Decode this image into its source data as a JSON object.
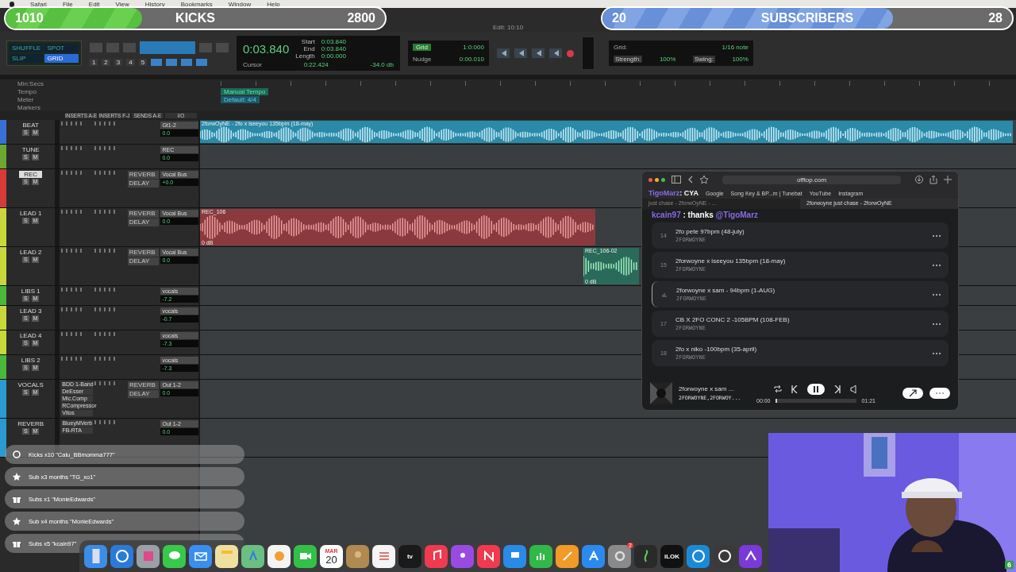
{
  "menu_bar": {
    "items": [
      "Safari",
      "File",
      "Edit",
      "View",
      "History",
      "Bookmarks",
      "Window",
      "Help"
    ]
  },
  "kicks_goal": {
    "current": "1010",
    "label": "KICKS",
    "target": "2800",
    "level": 0.36
  },
  "subs_goal": {
    "current": "20",
    "label": "SUBSCRIBERS",
    "target": "28",
    "level": 0.71
  },
  "edit_window": {
    "title": "Edit: 10:10"
  },
  "toolbar": {
    "edit_modes": [
      {
        "label": "SHUFFLE",
        "selected": false
      },
      {
        "label": "SPOT",
        "selected": false
      },
      {
        "label": "SLIP",
        "selected": false
      },
      {
        "label": "GRID",
        "selected": true
      }
    ],
    "zoom_presets": [
      "1",
      "2",
      "3",
      "4",
      "5"
    ],
    "counter": "0:03.840",
    "start_label": "Start",
    "end_label": "End",
    "length_label": "Length",
    "start": "0:03.840",
    "end": "0:03.840",
    "length": "0:00.000",
    "cursor_label": "Cursor",
    "cursor": "0:22.424",
    "cursor_level": "-34.0 db",
    "grid_mode": "Grid",
    "grid_value": "1:0:000",
    "nudge_label": "Nudge",
    "nudge_value": "0:00.010",
    "grid_label": "Grid:",
    "grid_note": "1/16 note",
    "strength_label": "Strength:",
    "strength": "100%",
    "swing_label": "Swing:",
    "swing": "100%"
  },
  "rulers": [
    {
      "label": "Min:Secs"
    },
    {
      "label": "Tempo",
      "value": "Manual Tempo"
    },
    {
      "label": "Meter",
      "value": "Default: 4/4"
    },
    {
      "label": "Markers"
    }
  ],
  "columns": [
    "INSERTS A-E",
    "INSERTS F-J",
    "SENDS A-E",
    "I/O"
  ],
  "tracks": [
    {
      "name": "BEAT",
      "color": "#3a6fd8",
      "kind": "small",
      "buttons": [
        "S",
        "M"
      ],
      "io": "Gt1-2",
      "vol": "0.0",
      "clip": {
        "kind": "full",
        "name": "2forwOyNE - 2fo x iseeyou 135bpm (18-may)"
      },
      "record": false
    },
    {
      "name": "TUNE",
      "color": "#6aa832",
      "kind": "small",
      "buttons": [
        "S",
        "M"
      ],
      "io": "REC",
      "vol": "0.0",
      "record": false
    },
    {
      "name": "REC",
      "color": "#d83a3a",
      "kind": "tall",
      "buttons": [
        "S",
        "M"
      ],
      "sends": [
        "REVERB",
        "DELAY"
      ],
      "io": "Vocal Bus",
      "vol": "+0.0",
      "record": true
    },
    {
      "name": "LEAD 1",
      "color": "#c8d83a",
      "kind": "tall",
      "buttons": [
        "S",
        "M"
      ],
      "sends": [
        "REVERB",
        "DELAY"
      ],
      "io": "Vocal Bus",
      "vol": "0.0",
      "clip": {
        "kind": "left",
        "name": "REC_106",
        "gain": "0 dB"
      },
      "record": false
    },
    {
      "name": "LEAD 2",
      "color": "#c8d83a",
      "kind": "tall",
      "buttons": [
        "S",
        "M"
      ],
      "sends": [
        "REVERB",
        "DELAY"
      ],
      "io": "Vocal Bus",
      "vol": "0.0",
      "clip": {
        "kind": "short",
        "name": "REC_106-02",
        "gain": "0 dB"
      },
      "record": false
    },
    {
      "name": "LIBS 1",
      "color": "#4ab83a",
      "kind": "mini",
      "buttons": [
        "S",
        "M"
      ],
      "io": "vocals",
      "vol": "-7.2",
      "record": false
    },
    {
      "name": "LEAD 3",
      "color": "#c8d83a",
      "kind": "small",
      "buttons": [
        "S",
        "M"
      ],
      "io": "vocals",
      "vol": "-0.7",
      "record": false
    },
    {
      "name": "LEAD 4",
      "color": "#c8d83a",
      "kind": "small",
      "buttons": [
        "S",
        "M"
      ],
      "io": "vocals",
      "vol": "-7.3",
      "record": false
    },
    {
      "name": "LIBS 2",
      "color": "#4ab83a",
      "kind": "small",
      "buttons": [
        "S",
        "M"
      ],
      "io": "vocals",
      "vol": "-7.3",
      "record": false
    },
    {
      "name": "VOCALS",
      "color": "#2a9ad0",
      "kind": "tall",
      "buttons": [
        "S",
        "M"
      ],
      "inserts": [
        "BDD 1-Band",
        "DeEsser",
        "Mic.Comp",
        "RCompressor",
        "Vitos"
      ],
      "sends": [
        "REVERB",
        "DELAY"
      ],
      "io": "Out 1-2",
      "vol": "0.0",
      "record": false
    },
    {
      "name": "REVERB",
      "color": "#2a9ad0",
      "kind": "tall",
      "buttons": [
        "S",
        "M"
      ],
      "inserts": [
        "BlueyMVerb",
        "FB-RTA"
      ],
      "io": "Out 1-2",
      "vol": "0.0",
      "record": false
    }
  ],
  "browser": {
    "url": "offtop.com",
    "bookmarks": [
      "Google",
      "Song Key & BP...m | Tunebat",
      "YouTube",
      "Instagram"
    ],
    "tabs": [
      {
        "label": "just chase - 2forwOyNE - ...",
        "selected": false
      },
      {
        "label": "2forwoyne just chase - 2forwOyNE",
        "selected": true
      }
    ],
    "songs": [
      {
        "number": "14",
        "title": "2fo pete 97bpm (48-july)",
        "artist": "2FORWOYNE",
        "playing": false
      },
      {
        "number": "15",
        "title": "2forwoyne x iseeyou 135bpm (18-may)",
        "artist": "2FORWOYNE",
        "playing": false
      },
      {
        "title": "2forwoyne x sam - 94bpm (1-AUG)",
        "artist": "2FORWOYNE",
        "playing": true
      },
      {
        "number": "17",
        "title": "CB X 2FO CONC 2 -105BPM (108-FEB)",
        "artist": "2FORWOYNE",
        "playing": false
      },
      {
        "number": "18",
        "title": "2fo x niko -100bpm (35-april)",
        "artist": "2FORWOYNE",
        "playing": false
      }
    ],
    "player": {
      "title": "2forwoyne x sam ...",
      "artist": "2FORWOYNE,2FORWOY...",
      "elapsed": "00:00",
      "duration": "01:21",
      "level": 0.02,
      "paused": false
    }
  },
  "chat": [
    {
      "user": "TigoMarz",
      "message": ": CYA"
    },
    {
      "user": "kcain97",
      "message": " : thanks ",
      "mention": "@TigoMarz"
    }
  ],
  "alerts": [
    {
      "kind": "kick",
      "text": "Kicks x10 \"Calu_BBmomma777\""
    },
    {
      "kind": "sub",
      "text": "Sub x3 months \"TG_xo1\""
    },
    {
      "kind": "gift",
      "text": "Subs x1 \"MonieEdwards\""
    },
    {
      "kind": "sub",
      "text": "Sub x4 months \"MonieEdwards\""
    },
    {
      "kind": "gift",
      "text": "Subs x5 \"kcain97\""
    }
  ],
  "dock": [
    {
      "kind": "finder"
    },
    {
      "kind": "safari"
    },
    {
      "kind": "launchpad"
    },
    {
      "kind": "messages"
    },
    {
      "kind": "mail"
    },
    {
      "kind": "notes"
    },
    {
      "kind": "maps"
    },
    {
      "kind": "photos"
    },
    {
      "kind": "facetime"
    },
    {
      "kind": "calendar",
      "month": "MAR",
      "day": "20"
    },
    {
      "kind": "contacts"
    },
    {
      "kind": "reminders"
    },
    {
      "kind": "tv",
      "label": "tv"
    },
    {
      "kind": "music"
    },
    {
      "kind": "podcasts"
    },
    {
      "kind": "news"
    },
    {
      "kind": "keynote"
    },
    {
      "kind": "numbers"
    },
    {
      "kind": "pages"
    },
    {
      "kind": "appstore"
    },
    {
      "kind": "settings",
      "badge": "2"
    },
    {
      "kind": "musescore"
    },
    {
      "kind": "ilok",
      "label": "iLOK"
    },
    {
      "kind": "ring"
    },
    {
      "kind": "logic"
    },
    {
      "kind": "protools"
    }
  ],
  "corner_badge": {
    "count": "6"
  }
}
